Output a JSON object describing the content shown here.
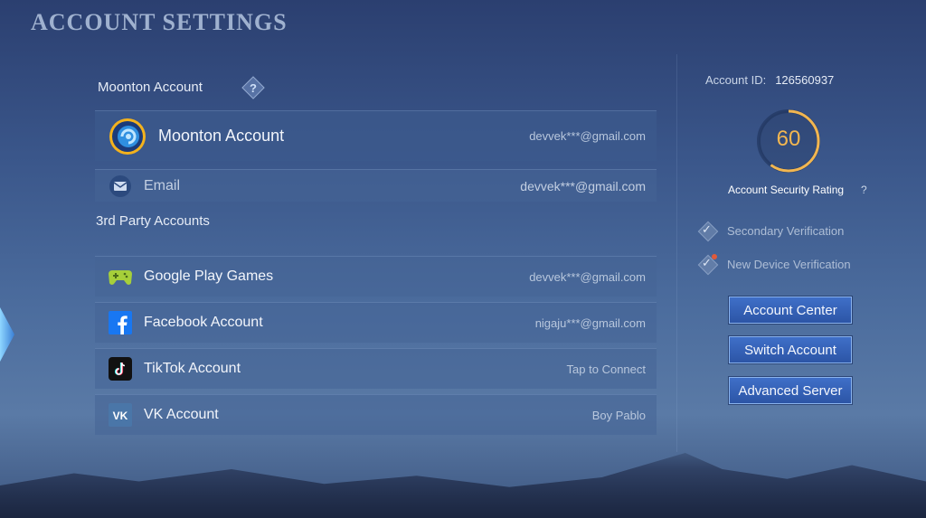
{
  "header": {
    "title": "ACCOUNT SETTINGS"
  },
  "moonton_section": {
    "label": "Moonton Account",
    "help": "?"
  },
  "moonton_rows": [
    {
      "label": "Moonton Account",
      "value": "devvek***@gmail.com",
      "icon": "moonton-logo-icon"
    },
    {
      "label": "Email",
      "value": "devvek***@gmail.com",
      "icon": "envelope-icon"
    }
  ],
  "third_party": {
    "label": "3rd Party Accounts",
    "rows": [
      {
        "label": "Google Play Games",
        "value": "devvek***@gmail.com",
        "icon": "gamepad-icon"
      },
      {
        "label": "Facebook Account",
        "value": "nigaju***@gmail.com",
        "icon": "facebook-icon"
      },
      {
        "label": "TikTok Account",
        "value": "Tap to Connect",
        "icon": "tiktok-icon"
      },
      {
        "label": "VK Account",
        "value": "Boy Pablo",
        "icon": "vk-icon"
      }
    ]
  },
  "account": {
    "id_label": "Account ID:",
    "id_value": "126560937",
    "security_rating": "60",
    "security_rating_value": 60,
    "security_rating_max": 100,
    "security_label": "Account Security Rating",
    "security_help": "?"
  },
  "verifications": [
    {
      "label": "Secondary Verification"
    },
    {
      "label": "New Device Verification"
    }
  ],
  "buttons": {
    "account_center": "Account Center",
    "switch_account": "Switch Account",
    "advanced_server": "Advanced Server"
  },
  "colors": {
    "accent": "#f2b650",
    "button": "#3f6fc8",
    "alert_dot": "#e05a3a"
  }
}
